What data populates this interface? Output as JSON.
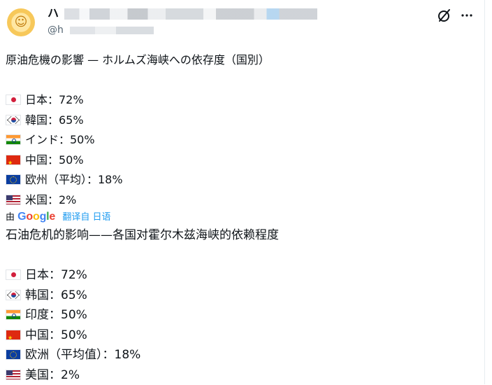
{
  "author": {
    "display_name_visible": "ハ",
    "handle_visible": "@h"
  },
  "icons": {
    "grok": "grok-icon",
    "more": "more-options-icon",
    "avatar": "sun-avatar"
  },
  "tweet": {
    "lines": [
      {
        "flag": "",
        "text": "原油危機の影響 — ホルムズ海峡への依存度（国別）"
      },
      {
        "flag": "",
        "text": ""
      },
      {
        "flag": "jp",
        "text": "日本：72%"
      },
      {
        "flag": "kr",
        "text": "韓国：65%"
      },
      {
        "flag": "in",
        "text": "インド：50%"
      },
      {
        "flag": "cn",
        "text": "中国：50%"
      },
      {
        "flag": "eu",
        "text": "欧州（平均）：18%"
      },
      {
        "flag": "us",
        "text": "米国：2%"
      }
    ]
  },
  "translation": {
    "by_label": "由",
    "provider": "Google",
    "link_label": "翻译自 日语",
    "lines": [
      {
        "flag": "",
        "text": "石油危机的影响——各国对霍尔木兹海峡的依赖程度"
      },
      {
        "flag": "",
        "text": ""
      },
      {
        "flag": "jp",
        "text": "日本：72%"
      },
      {
        "flag": "kr",
        "text": "韩国：65%"
      },
      {
        "flag": "in",
        "text": "印度：50%"
      },
      {
        "flag": "cn",
        "text": "中国：50%"
      },
      {
        "flag": "eu",
        "text": "欧洲（平均值）：18%"
      },
      {
        "flag": "us",
        "text": "美国：2%"
      }
    ]
  },
  "colors": {
    "text": "#0f1419",
    "secondary": "#536471",
    "link": "#1d9bf0"
  }
}
